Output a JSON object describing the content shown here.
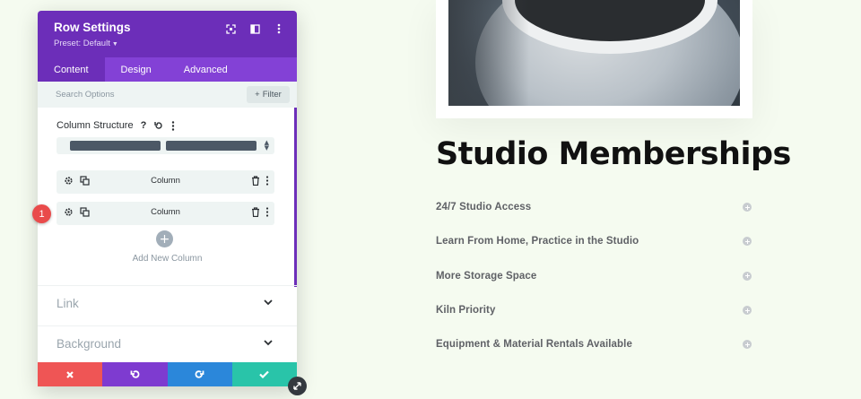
{
  "panel": {
    "title": "Row Settings",
    "preset": "Preset: Default",
    "tabs": [
      {
        "label": "Content",
        "active": true
      },
      {
        "label": "Design",
        "active": false
      },
      {
        "label": "Advanced",
        "active": false
      }
    ],
    "search_placeholder": "Search Options",
    "filter_label": "Filter",
    "column_structure_label": "Column Structure",
    "help_glyph": "?",
    "columns": [
      {
        "label": "Column"
      },
      {
        "label": "Column"
      }
    ],
    "add_column_label": "Add New Column",
    "sections": [
      {
        "label": "Link"
      },
      {
        "label": "Background"
      }
    ]
  },
  "badge": "1",
  "page": {
    "title": "Studio Memberships",
    "accordion": [
      "24/7 Studio Access",
      "Learn From Home, Practice in the Studio",
      "More Storage Space",
      "Kiln Priority",
      "Equipment & Material Rentals Available"
    ]
  },
  "colors": {
    "panel_header": "#6c2eb9",
    "tabs_bar": "#8341d6",
    "cancel": "#ef5555",
    "undo": "#7e3bd0",
    "redo": "#2b87da",
    "save": "#29c4a9",
    "badge": "#e94b4b",
    "page_bg": "#f5fbf0"
  },
  "icons": {
    "header": [
      "fullscreen-icon",
      "split-view-icon",
      "more-vertical-icon"
    ],
    "column_row": [
      "gear-icon",
      "duplicate-icon",
      "trash-icon",
      "more-vertical-icon"
    ],
    "actions": [
      "close-icon",
      "undo-icon",
      "redo-icon",
      "check-icon"
    ]
  }
}
